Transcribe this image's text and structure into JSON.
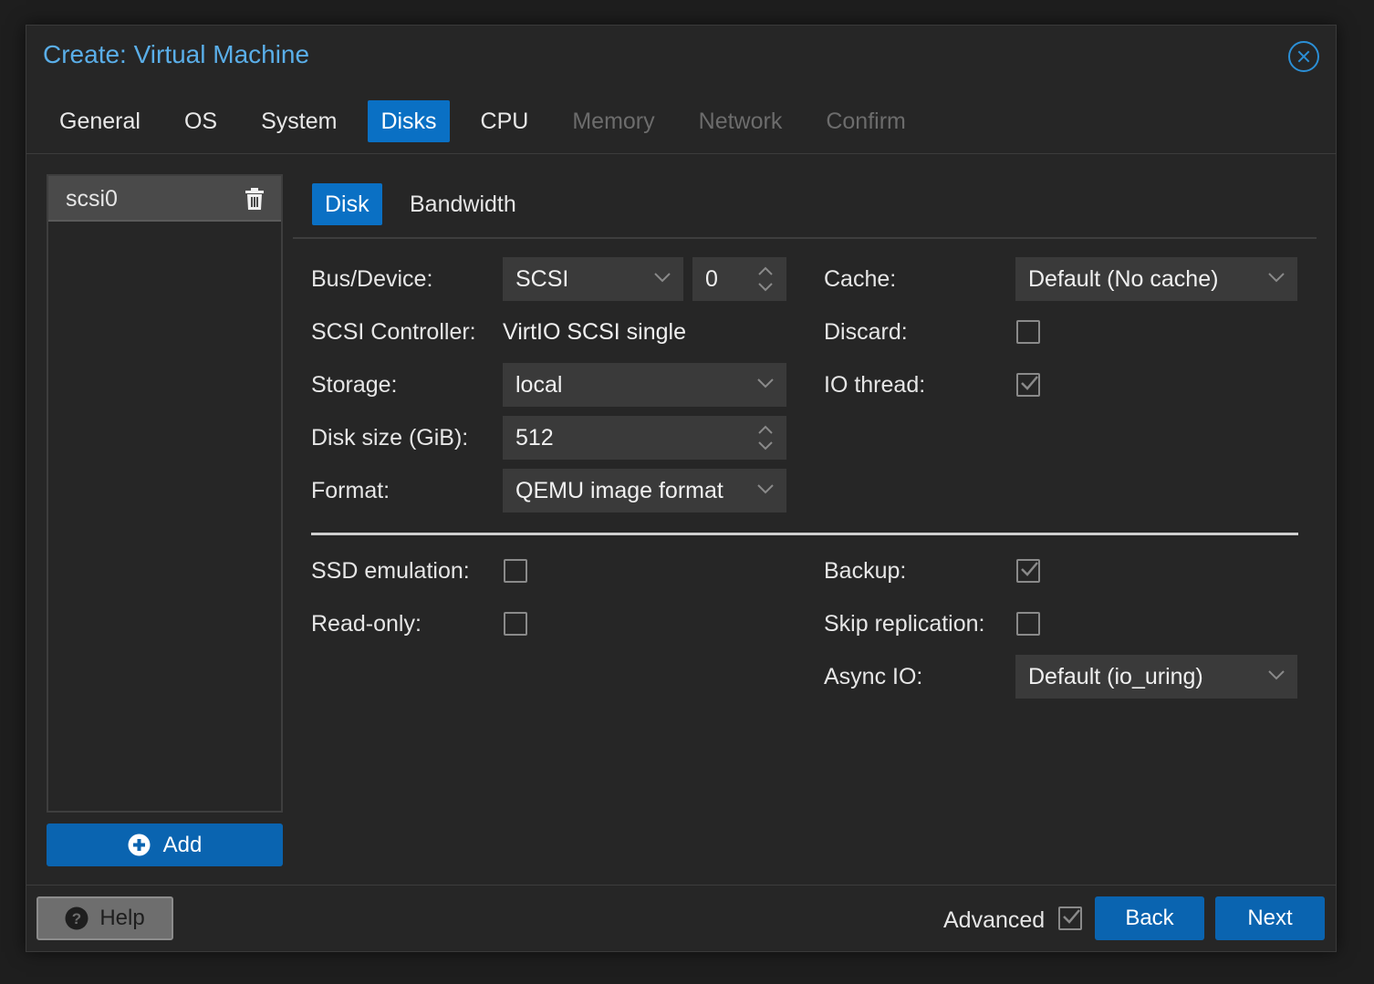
{
  "dialog": {
    "title": "Create: Virtual Machine"
  },
  "tabs": [
    {
      "label": "General",
      "state": "normal"
    },
    {
      "label": "OS",
      "state": "normal"
    },
    {
      "label": "System",
      "state": "normal"
    },
    {
      "label": "Disks",
      "state": "active"
    },
    {
      "label": "CPU",
      "state": "normal"
    },
    {
      "label": "Memory",
      "state": "disabled"
    },
    {
      "label": "Network",
      "state": "disabled"
    },
    {
      "label": "Confirm",
      "state": "disabled"
    }
  ],
  "disk_list": {
    "items": [
      "scsi0"
    ],
    "add_label": "Add"
  },
  "subtabs": {
    "disk": "Disk",
    "bandwidth": "Bandwidth"
  },
  "form": {
    "bus_device": {
      "label": "Bus/Device:",
      "bus": "SCSI",
      "device": "0"
    },
    "scsi_controller": {
      "label": "SCSI Controller:",
      "value": "VirtIO SCSI single"
    },
    "storage": {
      "label": "Storage:",
      "value": "local"
    },
    "disk_size": {
      "label": "Disk size (GiB):",
      "value": "512"
    },
    "format": {
      "label": "Format:",
      "value": "QEMU image format"
    },
    "cache": {
      "label": "Cache:",
      "value": "Default (No cache)"
    },
    "discard": {
      "label": "Discard:",
      "checked": false
    },
    "io_thread": {
      "label": "IO thread:",
      "checked": true
    },
    "ssd_emulation": {
      "label": "SSD emulation:",
      "checked": false
    },
    "read_only": {
      "label": "Read-only:",
      "checked": false
    },
    "backup": {
      "label": "Backup:",
      "checked": true
    },
    "skip_replication": {
      "label": "Skip replication:",
      "checked": false
    },
    "async_io": {
      "label": "Async IO:",
      "value": "Default (io_uring)"
    }
  },
  "footer": {
    "help": "Help",
    "advanced": "Advanced",
    "advanced_checked": true,
    "back": "Back",
    "next": "Next"
  },
  "colors": {
    "accent": "#0a70c4",
    "title": "#5aaee8",
    "background": "#262626",
    "field": "#3a3a3a"
  }
}
